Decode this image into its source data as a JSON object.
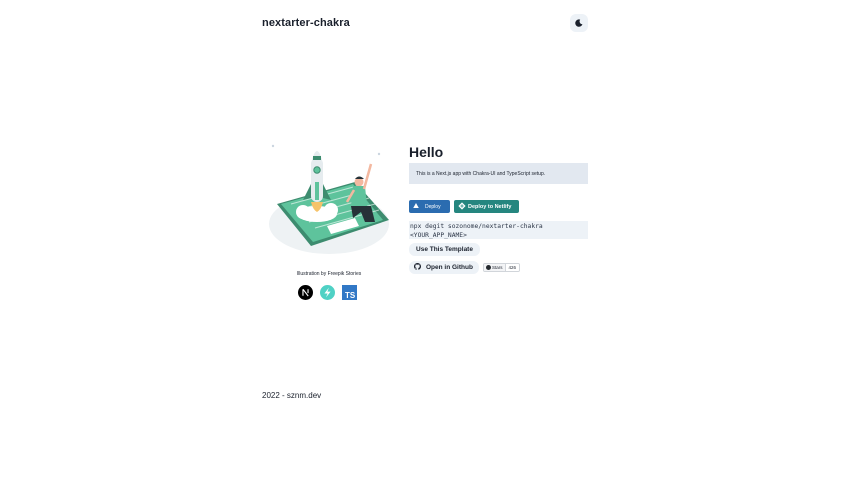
{
  "header": {
    "brand": "nextarter-chakra",
    "theme_toggle_icon": "moon-icon"
  },
  "hero": {
    "illustration_credit": "Illustration by Freepik Stories",
    "tech_icons": [
      "nextjs-icon",
      "chakra-ui-icon",
      "typescript-icon"
    ],
    "title": "Hello",
    "description": "This is a Next.js app with Chakra-UI and TypeScript setup.",
    "deploy_vercel_label": "Deploy",
    "deploy_netlify_label": "Deploy to Netlify",
    "command": "npx degit sozonome/nextarter-chakra\n<YOUR_APP_NAME>",
    "use_template_label": "Use This Template",
    "open_github_label": "Open in Github",
    "stars_label": "Stars",
    "stars_count": "426"
  },
  "footer": {
    "text": "2022 - sznm.dev"
  },
  "colors": {
    "vercel_button": "#2b6cb0",
    "netlify_button": "#25867f",
    "accent_green": "#5ec39c",
    "panel_gray": "#e2e8f0"
  }
}
